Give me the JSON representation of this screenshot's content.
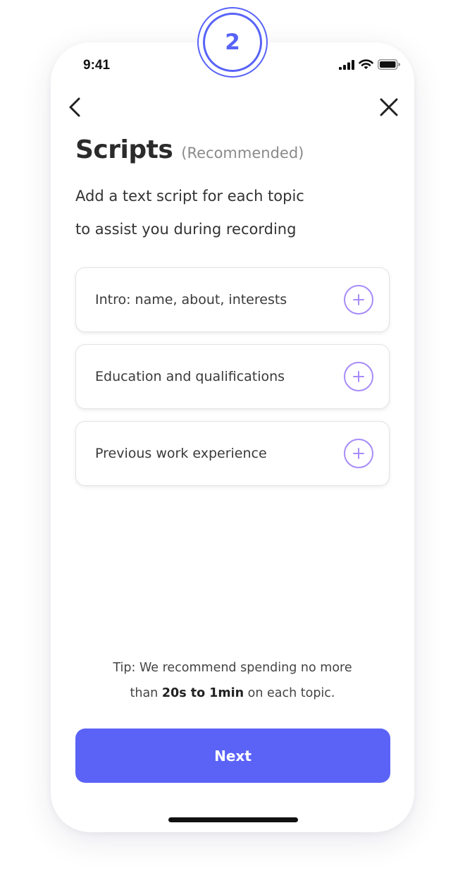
{
  "step_badge": {
    "number": "2"
  },
  "status_bar": {
    "time": "9:41",
    "icons": [
      "cellular-signal-icon",
      "wifi-icon",
      "battery-icon"
    ]
  },
  "nav": {
    "back_icon": "chevron-left-icon",
    "close_icon": "close-icon"
  },
  "header": {
    "title": "Scripts",
    "title_suffix": "(Recommended)",
    "subtitle_line1": "Add a text script for each topic",
    "subtitle_line2": "to assist you during recording"
  },
  "topics": [
    {
      "label": "Intro: name, about, interests",
      "action_icon": "plus-circle-icon"
    },
    {
      "label": "Education and qualifications",
      "action_icon": "plus-circle-icon"
    },
    {
      "label": "Previous work experience",
      "action_icon": "plus-circle-icon"
    }
  ],
  "tip": {
    "line1": "Tip: We recommend spending no more",
    "line2_prefix": "than ",
    "line2_bold": "20s to 1min",
    "line2_suffix": " on each topic."
  },
  "next_button": {
    "label": "Next"
  },
  "colors": {
    "accent": "#5863f8",
    "button_bg": "#5b63f7",
    "plus_icon": "#a78bfa",
    "title_text": "#2b2b2b",
    "muted_text": "#8a8a8a"
  }
}
